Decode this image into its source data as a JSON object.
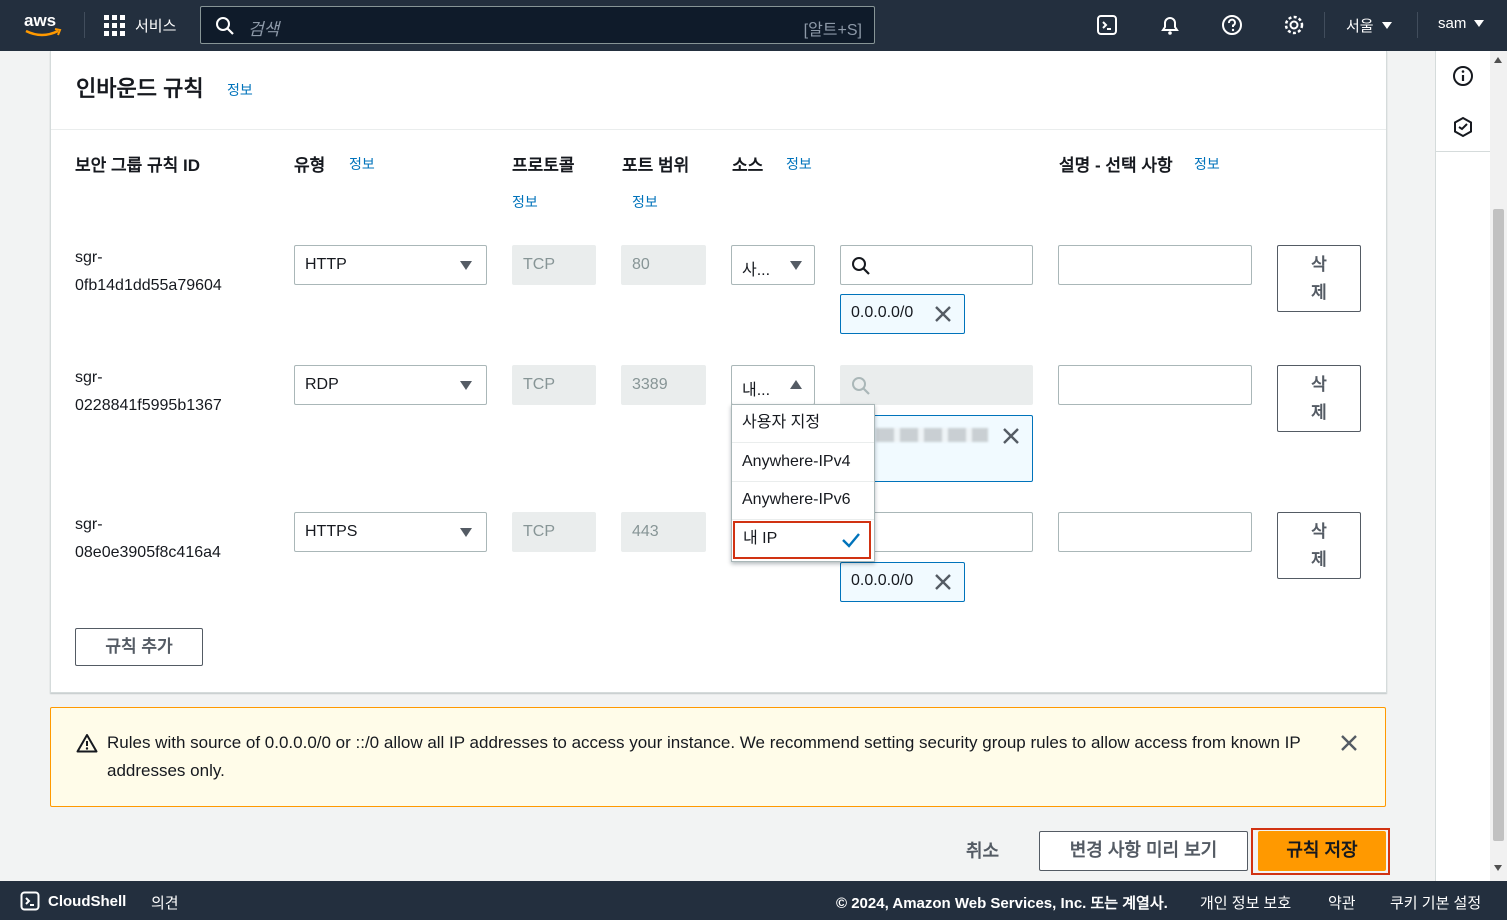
{
  "nav": {
    "logo": "aws",
    "services_label": "서비스",
    "search_placeholder": "검색",
    "search_shortcut": "[알트+S]",
    "icons": [
      "cloudshell-icon",
      "bell-icon",
      "help-icon",
      "gear-icon"
    ],
    "region": "서울",
    "user": "sam"
  },
  "panel": {
    "title": "인바운드 규칙",
    "title_info": "정보",
    "columns": {
      "rule_id": "보안 그룹 규칙 ID",
      "type": "유형",
      "type_info": "정보",
      "protocol": "프로토콜",
      "protocol_info": "정보",
      "port_range": "포트 범위",
      "port_info": "정보",
      "source": "소스",
      "source_info": "정보",
      "description": "설명 - 선택 사항",
      "description_info": "정보"
    },
    "rules": [
      {
        "id_line1": "sgr-",
        "id_line2": "0fb14d1dd55a79604",
        "type": "HTTP",
        "protocol": "TCP",
        "port": "80",
        "source": "사...",
        "token": "0.0.0.0/0",
        "delete_l1": "삭",
        "delete_l2": "제"
      },
      {
        "id_line1": "sgr-",
        "id_line2": "0228841f5995b1367",
        "type": "RDP",
        "protocol": "TCP",
        "port": "3389",
        "source": "내...",
        "token": "",
        "delete_l1": "삭",
        "delete_l2": "제"
      },
      {
        "id_line1": "sgr-",
        "id_line2": "08e0e3905f8c416a4",
        "type": "HTTPS",
        "protocol": "TCP",
        "port": "443",
        "source": "",
        "token": "0.0.0.0/0",
        "delete_l1": "삭",
        "delete_l2": "제"
      }
    ],
    "source_dropdown": {
      "options": [
        "사용자 지정",
        "Anywhere-IPv4",
        "Anywhere-IPv6",
        "내 IP"
      ],
      "selected": "내 IP"
    },
    "add_rule": "규칙 추가"
  },
  "warning": {
    "text": "Rules with source of 0.0.0.0/0 or ::/0 allow all IP addresses to access your instance. We recommend setting security group rules to allow access from known IP addresses only."
  },
  "actions": {
    "cancel": "취소",
    "preview": "변경 사항 미리 보기",
    "save": "규칙 저장"
  },
  "footer": {
    "cloudshell": "CloudShell",
    "feedback": "의견",
    "copyright": "© 2024, Amazon Web Services, Inc. 또는 계열사.",
    "privacy": "개인 정보 보호",
    "terms": "약관",
    "cookies": "쿠키 기본 설정"
  },
  "colors": {
    "nav_bg": "#232f3e",
    "link": "#0073bb",
    "primary": "#ff9900",
    "highlight": "#d13212",
    "warning_bg": "#fffce9"
  }
}
